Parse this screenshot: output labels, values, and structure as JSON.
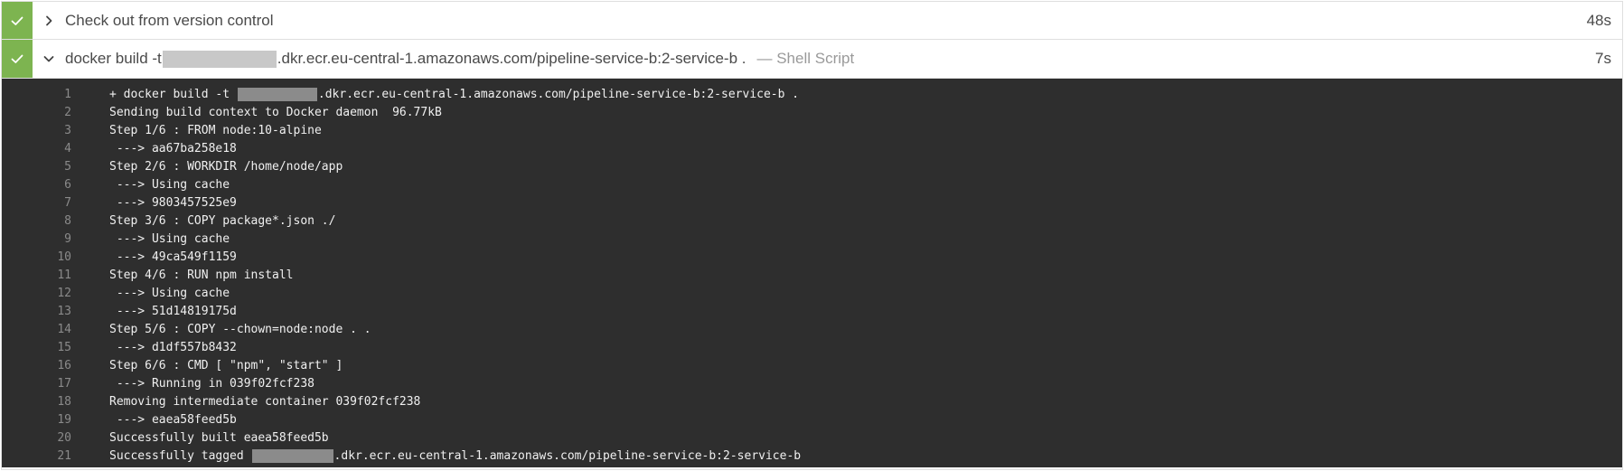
{
  "steps": [
    {
      "status": "success",
      "expanded": false,
      "title": "Check out from version control",
      "duration": "48s"
    },
    {
      "status": "success",
      "expanded": true,
      "title_prefix": "docker build -t ",
      "title_suffix": ".dkr.ecr.eu-central-1.amazonaws.com/pipeline-service-b:2-service-b .",
      "subtype": "— Shell Script",
      "duration": "7s"
    }
  ],
  "log": {
    "lines": [
      {
        "num": "1",
        "pre": "+ docker build -t ",
        "post": ".dkr.ecr.eu-central-1.amazonaws.com/pipeline-service-b:2-service-b ."
      },
      {
        "num": "2",
        "text": "Sending build context to Docker daemon  96.77kB"
      },
      {
        "num": "3",
        "text": "Step 1/6 : FROM node:10-alpine"
      },
      {
        "num": "4",
        "text": " ---> aa67ba258e18"
      },
      {
        "num": "5",
        "text": "Step 2/6 : WORKDIR /home/node/app"
      },
      {
        "num": "6",
        "text": " ---> Using cache"
      },
      {
        "num": "7",
        "text": " ---> 9803457525e9"
      },
      {
        "num": "8",
        "text": "Step 3/6 : COPY package*.json ./"
      },
      {
        "num": "9",
        "text": " ---> Using cache"
      },
      {
        "num": "10",
        "text": " ---> 49ca549f1159"
      },
      {
        "num": "11",
        "text": "Step 4/6 : RUN npm install"
      },
      {
        "num": "12",
        "text": " ---> Using cache"
      },
      {
        "num": "13",
        "text": " ---> 51d14819175d"
      },
      {
        "num": "14",
        "text": "Step 5/6 : COPY --chown=node:node . ."
      },
      {
        "num": "15",
        "text": " ---> d1df557b8432"
      },
      {
        "num": "16",
        "text": "Step 6/6 : CMD [ \"npm\", \"start\" ]"
      },
      {
        "num": "17",
        "text": " ---> Running in 039f02fcf238"
      },
      {
        "num": "18",
        "text": "Removing intermediate container 039f02fcf238"
      },
      {
        "num": "19",
        "text": " ---> eaea58feed5b"
      },
      {
        "num": "20",
        "text": "Successfully built eaea58feed5b"
      },
      {
        "num": "21",
        "pre": "Successfully tagged ",
        "post": ".dkr.ecr.eu-central-1.amazonaws.com/pipeline-service-b:2-service-b"
      }
    ]
  },
  "colors": {
    "success": "#7db450",
    "log_background": "#2e2e2e"
  },
  "icons": {
    "status": "check-icon",
    "collapsed": "chevron-right-icon",
    "expanded": "chevron-down-icon"
  }
}
